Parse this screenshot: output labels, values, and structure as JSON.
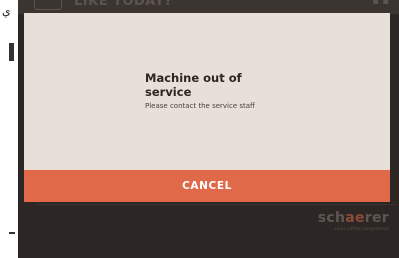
{
  "header": {
    "title": "LIKE TODAY?"
  },
  "dialog": {
    "title": "Machine out of service",
    "message": "Please contact the service staff",
    "cancel_label": "CANCEL"
  },
  "brand": {
    "name_start": "sch",
    "name_accent": "ae",
    "name_end": "rer",
    "tagline": "swiss coffee competence"
  },
  "side": {
    "glyph": "ي"
  },
  "colors": {
    "accent": "#e0694a",
    "dialog_bg": "#e8dfd8",
    "screen_bg": "#2f2a27"
  }
}
